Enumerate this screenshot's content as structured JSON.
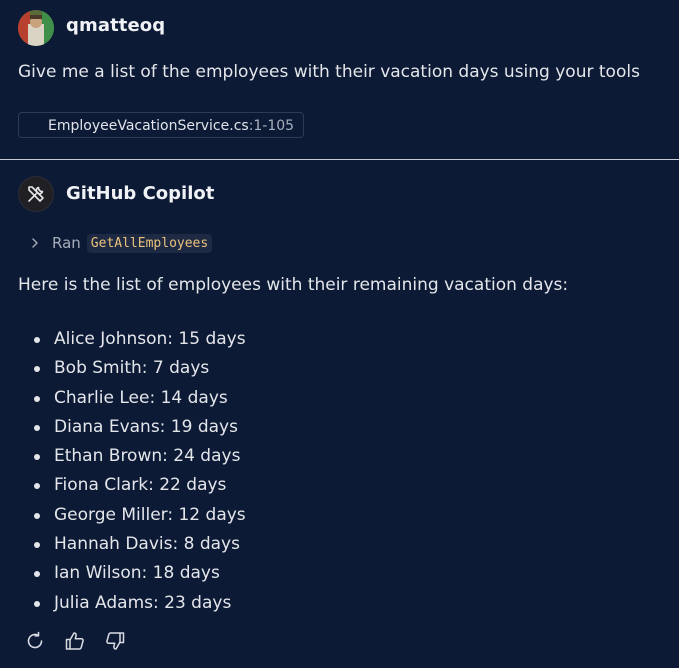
{
  "user": {
    "name": "qmatteoq",
    "avatar_icon": "user-avatar-photo",
    "prompt": "Give me a list of the employees with their vacation days using your tools",
    "attachment": {
      "file": "EmployeeVacationService.cs",
      "range": ":1-105",
      "icon": "csharp-file-icon"
    }
  },
  "assistant": {
    "name": "GitHub Copilot",
    "avatar_icon": "copilot-tools-icon",
    "tool_call": {
      "prefix": "Ran",
      "tool": "GetAllEmployees"
    },
    "intro": "Here is the list of employees with their remaining vacation days:",
    "employees": [
      "Alice Johnson: 15 days",
      "Bob Smith: 7 days",
      "Charlie Lee: 14 days",
      "Diana Evans: 19 days",
      "Ethan Brown: 24 days",
      "Fiona Clark: 22 days",
      "George Miller: 12 days",
      "Hannah Davis: 8 days",
      "Ian Wilson: 18 days",
      "Julia Adams: 23 days"
    ]
  },
  "actions": [
    "retry-icon",
    "thumbs-up-icon",
    "thumbs-down-icon"
  ],
  "colors": {
    "background": "#0c1a36",
    "text": "#e4e6ea",
    "code_text": "#e9c27c",
    "divider": "#c8ccd4"
  }
}
